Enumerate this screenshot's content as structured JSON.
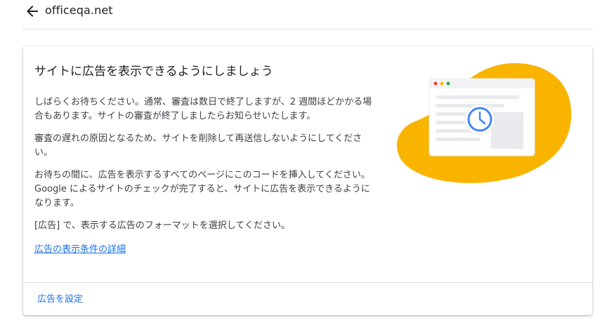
{
  "header": {
    "back_icon": "arrow-back-icon",
    "site_name": "officeqa.net"
  },
  "card": {
    "title": "サイトに広告を表示できるようにしましょう",
    "paragraphs": [
      "しばらくお待ちください。通常、審査は数日で終了しますが、2 週間ほどかかる場合もあります。サイトの審査が終了しましたらお知らせいたします。",
      "審査の遅れの原因となるため、サイトを削除して再送信しないようにしてください。",
      "お待ちの間に、広告を表示するすべてのページにこのコードを挿入してください。Google によるサイトのチェックが完了すると、サイトに広告を表示できるようになります。",
      "[広告] で、表示する広告のフォーマットを選択してください。"
    ],
    "details_link": "広告の表示条件の詳細",
    "illustration_icon": "clock-icon",
    "footer": {
      "setup_button": "広告を設定"
    }
  },
  "colors": {
    "accent": "#1a73e8",
    "blob": "#f9b400",
    "clock": "#4285f4",
    "divider": "#dadce0"
  }
}
